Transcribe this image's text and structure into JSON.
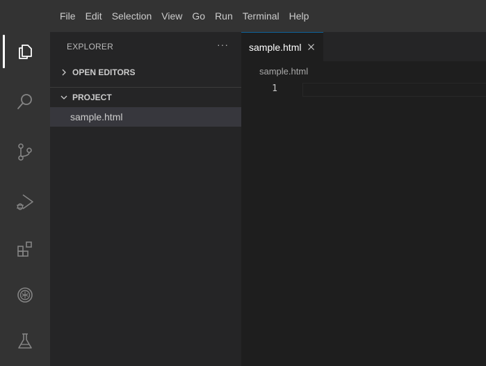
{
  "menubar": {
    "items": [
      "File",
      "Edit",
      "Selection",
      "View",
      "Go",
      "Run",
      "Terminal",
      "Help"
    ]
  },
  "activitybar": {
    "icons": [
      "explorer-icon",
      "search-icon",
      "source-control-icon",
      "run-debug-icon",
      "extensions-icon",
      "remote-icon",
      "testing-icon"
    ],
    "active": "explorer-icon"
  },
  "sidebar": {
    "title": "EXPLORER",
    "more_label": "···",
    "open_editors_label": "OPEN EDITORS",
    "project_label": "PROJECT",
    "files": [
      "sample.html"
    ]
  },
  "editor": {
    "tab_label": "sample.html",
    "breadcrumb": "sample.html",
    "line_numbers": [
      "1"
    ]
  },
  "colors": {
    "menubar_bg": "#333333",
    "sidebar_bg": "#252526",
    "editor_bg": "#1e1e1e",
    "selected_row": "#37373d",
    "accent": "#0e639c"
  }
}
